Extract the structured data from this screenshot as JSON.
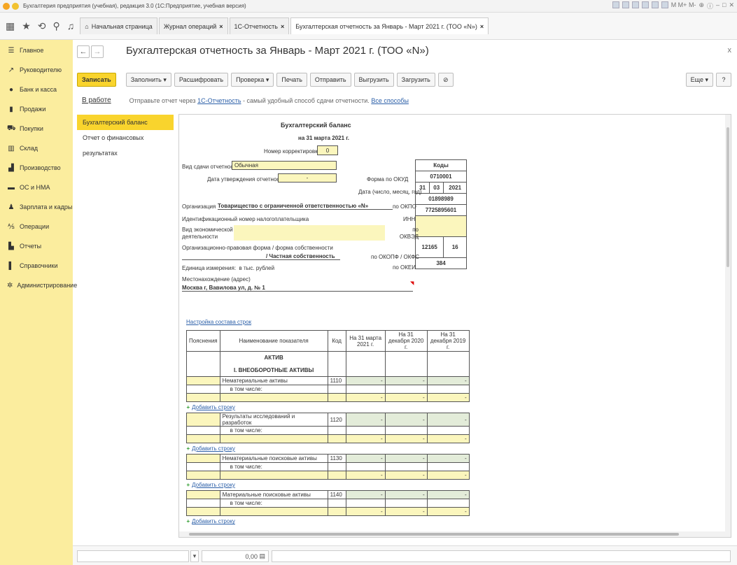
{
  "window": {
    "title": "Бухгалтерия предприятия (учебная), редакция 3.0 (1С:Предприятие, учебная версия)",
    "controls_text": "M  M+  M-"
  },
  "tabs": [
    {
      "label": "Начальная страница",
      "closable": false
    },
    {
      "label": "Журнал операций",
      "closable": true
    },
    {
      "label": "1С-Отчетность",
      "closable": true
    },
    {
      "label": "Бухгалтерская отчетность за Январь - Март 2021 г. (ТОО «N»)",
      "closable": true
    }
  ],
  "sidebar": {
    "items": [
      {
        "label": "Главное",
        "icon": "menu-icon"
      },
      {
        "label": "Руководителю",
        "icon": "trend-icon"
      },
      {
        "label": "Банк и касса",
        "icon": "coins-icon"
      },
      {
        "label": "Продажи",
        "icon": "bag-icon"
      },
      {
        "label": "Покупки",
        "icon": "cart-icon"
      },
      {
        "label": "Склад",
        "icon": "warehouse-icon"
      },
      {
        "label": "Производство",
        "icon": "factory-icon"
      },
      {
        "label": "ОС и НМА",
        "icon": "truck-icon"
      },
      {
        "label": "Зарплата и кадры",
        "icon": "person-icon"
      },
      {
        "label": "Операции",
        "icon": "operations-icon"
      },
      {
        "label": "Отчеты",
        "icon": "chart-icon"
      },
      {
        "label": "Справочники",
        "icon": "book-icon"
      },
      {
        "label": "Администрирование",
        "icon": "gear-icon"
      }
    ]
  },
  "document": {
    "title": "Бухгалтерская отчетность за Январь - Март 2021 г. (ТОО «N»)",
    "close": "x"
  },
  "toolbar": {
    "save": "Записать",
    "fill": "Заполнить",
    "decode": "Расшифровать",
    "check": "Проверка",
    "print": "Печать",
    "send": "Отправить",
    "export": "Выгрузить",
    "import": "Загрузить",
    "more": "Еще",
    "help": "?"
  },
  "status": {
    "state": "В работе",
    "hint_prefix": "Отправьте отчет через",
    "hint_link": "1С-Отчетность",
    "hint_middle": "- самый удобный способ сдачи отчетности.",
    "hint_link2": "Все способы"
  },
  "forms": [
    {
      "label": "Бухгалтерский баланс",
      "selected": true
    },
    {
      "label": "Отчет о финансовых результатах",
      "selected": false
    }
  ],
  "report": {
    "title": "Бухгалтерский баланс",
    "date": "на 31 марта 2021 г.",
    "correction_label": "Номер корректировки",
    "correction_value": "0",
    "submission_label": "Вид сдачи отчетности",
    "submission_value": "Обычная",
    "approval_label": "Дата утверждения отчетности",
    "approval_value": "-",
    "codes_header": "Коды",
    "okud_label": "Форма по ОКУД",
    "okud_value": "0710001",
    "date_label": "Дата (число, месяц, год)",
    "date_d": "31",
    "date_m": "03",
    "date_y": "2021",
    "org_label": "Организация",
    "org_value": "Товарищество с ограниченной ответственностью «N»",
    "okpo_label": "по ОКПО",
    "okpo_value": "01898989",
    "inn_line": "Идентификационный номер налогоплательщика",
    "inn_label": "ИНН",
    "inn_value": "7725895601",
    "activity_label": "Вид экономической деятельности",
    "okved_label": "по ОКВЭД",
    "legal_label": "Организационно-правовая форма / форма собственности",
    "legal_value": "/   Частная собственность",
    "okopf_label": "по ОКОПФ / ОКФС",
    "okopf_value": "12165",
    "okfs_value": "16",
    "unit_label": "Единица измерения:",
    "unit_value": "в тыс. рублей",
    "okei_label": "по ОКЕИ",
    "okei_value": "384",
    "location_label": "Местонахождение (адрес)",
    "location_value": "Москва г, Вавилова ул, д. № 1",
    "settings_link": "Настройка состава строк"
  },
  "table": {
    "headers": [
      "Пояснения",
      "Наименование показателя",
      "Код",
      "На 31 марта 2021 г.",
      "На 31 декабря 2020 г.",
      "На 31 декабря 2019 г."
    ],
    "section_asset": "АКТИВ",
    "section_noncurrent": "I. ВНЕОБОРОТНЫЕ АКТИВЫ",
    "in_total": "в том числе:",
    "add_row": "Добавить строку",
    "dash": "-",
    "rows": [
      {
        "name": "Нематериальные активы",
        "code": "1110"
      },
      {
        "name": "Результаты исследований и разработок",
        "code": "1120"
      },
      {
        "name": "Нематериальные поисковые активы",
        "code": "1130"
      },
      {
        "name": "Материальные поисковые активы",
        "code": "1140"
      }
    ]
  },
  "bottom": {
    "sum_value": "0,00"
  }
}
